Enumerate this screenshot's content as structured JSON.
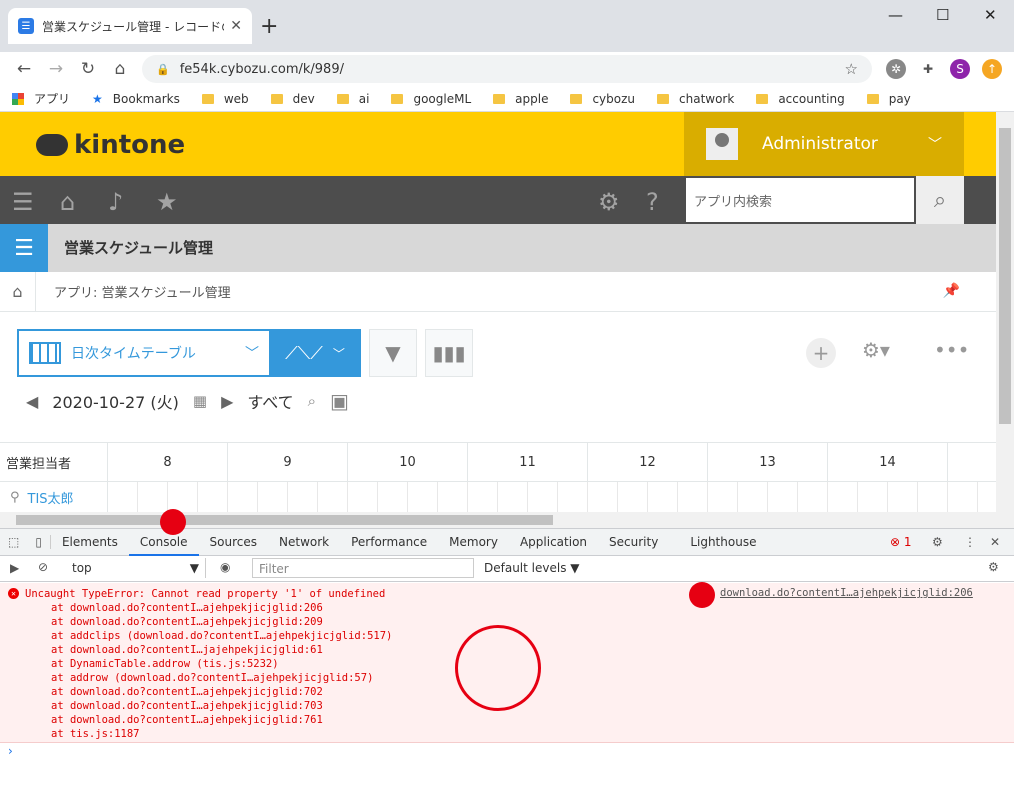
{
  "browser": {
    "tab_title": "営業スケジュール管理 - レコードの一覧",
    "url": "fe54k.cybozu.com/k/989/",
    "bookmarks": [
      "アプリ",
      "Bookmarks",
      "web",
      "dev",
      "ai",
      "googleML",
      "apple",
      "cybozu",
      "chatwork",
      "accounting",
      "pay"
    ],
    "profile_initial": "S"
  },
  "kintone": {
    "logo": "kintone",
    "user": "Administrator",
    "search_placeholder": "アプリ内検索",
    "app_title": "営業スケジュール管理",
    "breadcrumb": "アプリ: 営業スケジュール管理",
    "view_name": "日次タイムテーブル",
    "date": "2020-10-27 (火)",
    "filter_label": "すべて",
    "table_header": "営業担当者",
    "hours": [
      "8",
      "9",
      "10",
      "11",
      "12",
      "13",
      "14"
    ],
    "row_name": "TIS太郎"
  },
  "devtools": {
    "tabs": [
      "Elements",
      "Console",
      "Sources",
      "Network",
      "Performance",
      "Memory",
      "Application",
      "Security",
      "Lighthouse"
    ],
    "active_tab": "Console",
    "error_count": "1",
    "context": "top",
    "filter_placeholder": "Filter",
    "levels": "Default levels ▼",
    "error_message": "Uncaught TypeError: Cannot read property '1' of undefined",
    "error_source": "download.do?contentI…ajehpekjicjglid:206",
    "trace": [
      "at download.do?contentI…ajehpekjicjglid:206",
      "at download.do?contentI…ajehpekjicjglid:209",
      "at addclips (download.do?contentI…ajehpekjicjglid:517)",
      "at download.do?contentI…jajehpekjicjglid:61",
      "at DynamicTable.addrow (tis.js:5232)",
      "at addrow (download.do?contentI…ajehpekjicjglid:57)",
      "at download.do?contentI…ajehpekjicjglid:702",
      "at download.do?contentI…ajehpekjicjglid:703",
      "at download.do?contentI…ajehpekjicjglid:761",
      "at tis.js:1187"
    ]
  }
}
